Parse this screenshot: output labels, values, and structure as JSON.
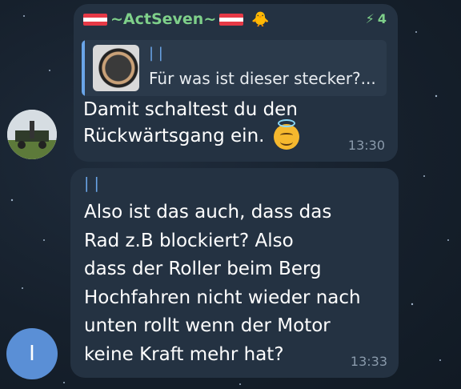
{
  "colors": {
    "background": "#16202c",
    "bubble": "#243242",
    "sender_name": "#7fd08a",
    "reply_accent": "#6aa5e8",
    "timestamp": "#8a9aab"
  },
  "avatars": [
    {
      "description": "group photo avatar"
    },
    {
      "initial": "I",
      "color": "#5a8fd6"
    }
  ],
  "messages": [
    {
      "sender": "~ActSeven~",
      "boost_count": "4",
      "reply_to": {
        "name": "| |",
        "text": "Für was ist dieser stecker?..."
      },
      "lines": [
        "Damit schaltest du den",
        "Rückwärtsgang ein."
      ],
      "emoji": "smiling-face-with-halo",
      "time": "13:30"
    },
    {
      "sender": "| |",
      "lines": [
        "Also ist das auch, dass das",
        "Rad z.B blockiert? Also",
        "dass der Roller beim Berg",
        "Hochfahren nicht wieder nach",
        "unten rollt wenn der Motor",
        "keine Kraft mehr hat?"
      ],
      "time": "13:33"
    }
  ]
}
